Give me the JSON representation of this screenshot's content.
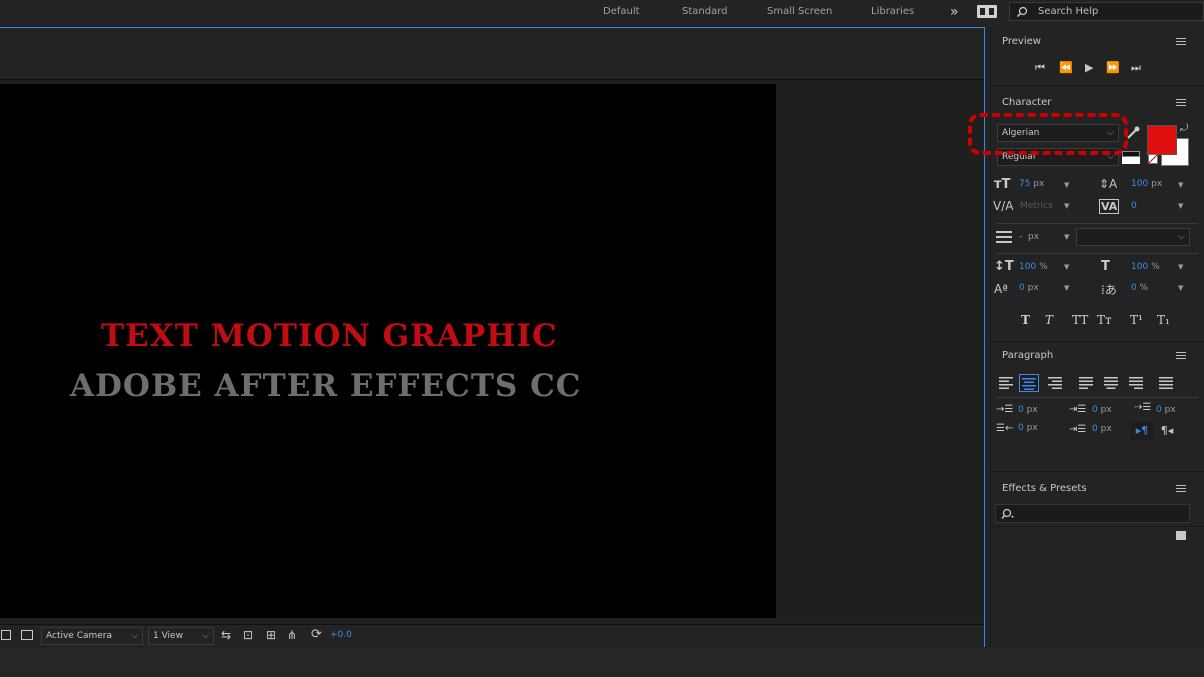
{
  "workspaces": {
    "default": "Default",
    "standard": "Standard",
    "small_screen": "Small Screen",
    "libraries": "Libraries",
    "more": "»"
  },
  "search": {
    "placeholder": "Search Help"
  },
  "composition": {
    "line1": "TEXT MOTION GRAPHIC",
    "line2": "ADOBE AFTER EFFECTS CC",
    "line1_color": "#c00c12",
    "line2_color": "#6e6e6e"
  },
  "viewer_bar": {
    "camera": "Active Camera",
    "views": "1 View",
    "exposure": "+0.0"
  },
  "preview": {
    "title": "Preview"
  },
  "character": {
    "title": "Character",
    "font_family": "Algerian",
    "font_style": "Regular",
    "fill_color": "#e01010",
    "size_value": "75",
    "size_unit": "px",
    "leading_value": "100",
    "leading_unit": "px",
    "kerning_value": "Metrics",
    "tracking_value": "0",
    "stroke_value": "-",
    "stroke_unit": "px",
    "vscale_value": "100",
    "vscale_unit": "%",
    "hscale_value": "100",
    "hscale_unit": "%",
    "baseline_value": "0",
    "baseline_unit": "px",
    "tsume_value": "0",
    "tsume_unit": "%",
    "styles": [
      "T",
      "T",
      "TT",
      "Tт",
      "T¹",
      "T₁"
    ]
  },
  "paragraph": {
    "title": "Paragraph",
    "indent_left": "0",
    "indent_right": "0",
    "indent_first": "0",
    "space_before": "0",
    "space_after": "0",
    "unit": "px"
  },
  "effects": {
    "title": "Effects & Presets"
  },
  "colors": {
    "accent": "#2d8ceb",
    "highlight_border": "#cc0000"
  }
}
